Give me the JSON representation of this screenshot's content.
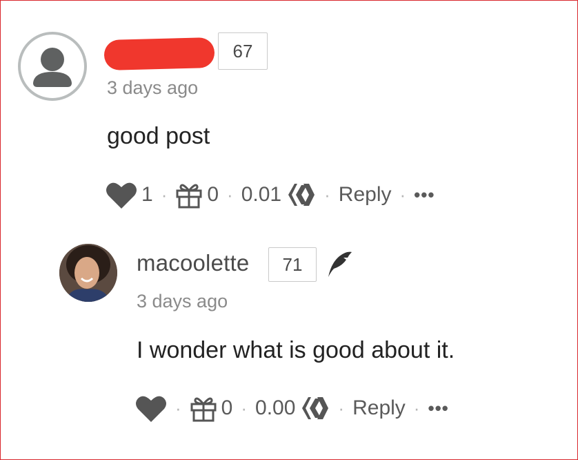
{
  "comments": [
    {
      "username": "",
      "username_redacted": true,
      "reputation": "67",
      "time": "3 days ago",
      "body": "good post",
      "votes": "1",
      "gifts": "0",
      "payout": "0.01",
      "reply_label": "Reply",
      "more_label": "•••"
    },
    {
      "username": "macoolette",
      "reputation": "71",
      "time": "3 days ago",
      "body": "I wonder what is good about it.",
      "votes": "",
      "gifts": "0",
      "payout": "0.00",
      "reply_label": "Reply",
      "more_label": "•••"
    }
  ],
  "separator": "·",
  "colors": {
    "redaction": "#f0372d",
    "icon": "#555555",
    "frame": "#d9262c"
  }
}
